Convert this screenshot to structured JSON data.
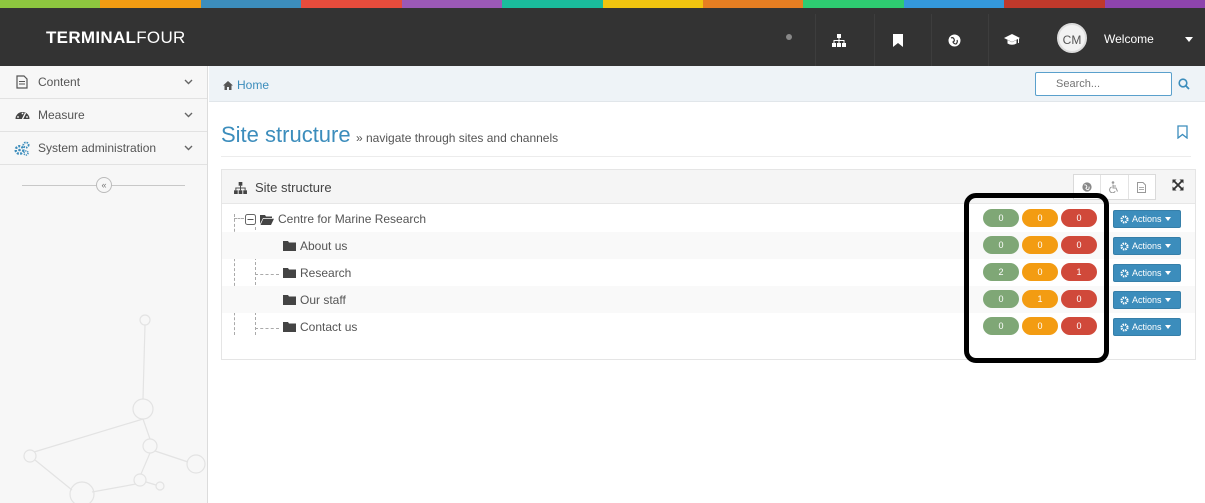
{
  "brand": {
    "bold": "TERMINAL",
    "thin": "FOUR"
  },
  "topbar": {
    "stripe_colors": [
      "#8dc63f",
      "#f39c12",
      "#3c8dbc",
      "#e74c3c",
      "#9b59b6",
      "#1abc9c",
      "#f1c40f",
      "#e67e22",
      "#2ecc71",
      "#3498db",
      "#c0392b",
      "#8e44ad"
    ],
    "icons": [
      "sitemap-icon",
      "bookmark-icon",
      "globe-icon",
      "graduation-cap-icon"
    ],
    "avatar_initials": "CM",
    "welcome": "Welcome"
  },
  "sidebar": {
    "items": [
      {
        "label": "Content",
        "icon": "file-icon"
      },
      {
        "label": "Measure",
        "icon": "dashboard-icon"
      },
      {
        "label": "System administration",
        "icon": "cogs-icon"
      }
    ],
    "collapse_glyph": "«"
  },
  "breadcrumb": {
    "home": "Home"
  },
  "search": {
    "placeholder": "Search..."
  },
  "page": {
    "title": "Site structure",
    "subtitle": "» navigate through sites and channels"
  },
  "panel": {
    "title": "Site structure",
    "tools": [
      "globe-icon",
      "accessibility-icon",
      "document-icon"
    ]
  },
  "tree": {
    "actions_label": "Actions",
    "rows": [
      {
        "label": "Centre for Marine Research",
        "green": "0",
        "orange": "0",
        "red": "0"
      },
      {
        "label": "About us",
        "green": "0",
        "orange": "0",
        "red": "0"
      },
      {
        "label": "Research",
        "green": "2",
        "orange": "0",
        "red": "1"
      },
      {
        "label": "Our staff",
        "green": "0",
        "orange": "1",
        "red": "0"
      },
      {
        "label": "Contact us",
        "green": "0",
        "orange": "0",
        "red": "0"
      }
    ]
  },
  "colors": {
    "accent": "#3c8dbc",
    "topbar": "#333333",
    "green": "#7fa776",
    "orange": "#f39c12",
    "red": "#d0493a"
  }
}
